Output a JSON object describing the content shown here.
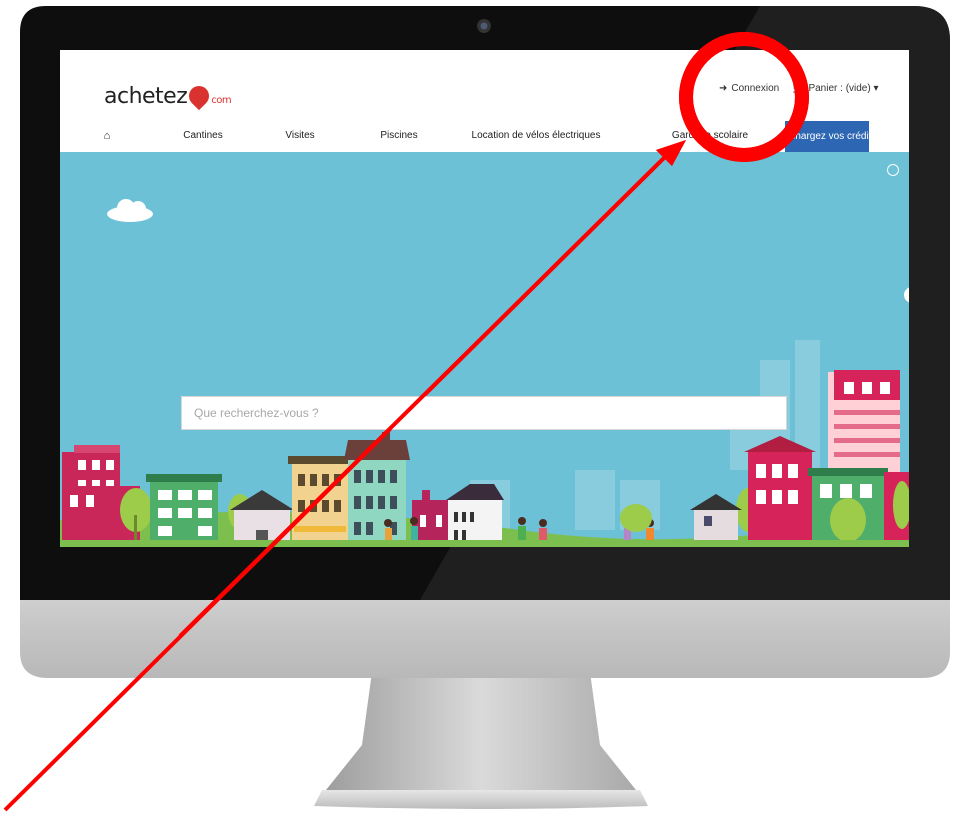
{
  "site": {
    "logo_text": "achetez",
    "logo_domain": "com"
  },
  "header": {
    "login_label": "Connexion",
    "cart_label": "Panier : (vide)"
  },
  "nav": {
    "home_icon": "home-icon",
    "items": [
      "Cantines",
      "Visites",
      "Piscines",
      "Location de vélos électriques",
      "Garderie scolaire"
    ],
    "cta_label": "Rechargez vos crédits"
  },
  "search": {
    "placeholder": "Que recherchez-vous ?"
  },
  "colors": {
    "sky": "#6cc1d6",
    "cta": "#2d66b3",
    "brand_red": "#d9322f",
    "annotation_red": "#ff0000"
  }
}
